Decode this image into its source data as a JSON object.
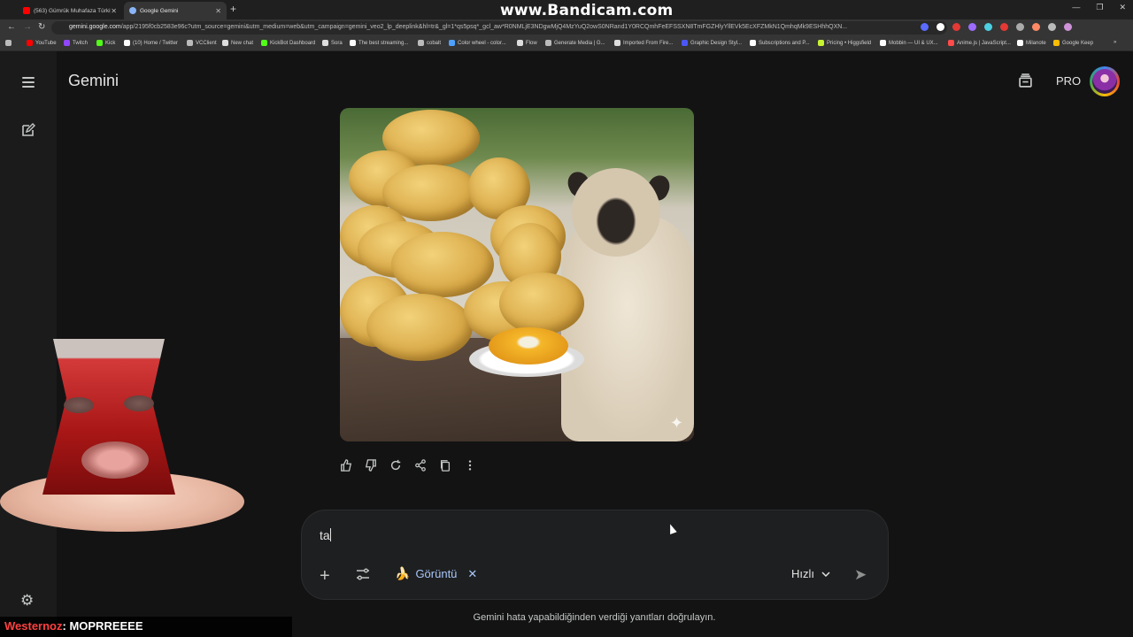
{
  "browser": {
    "tabs": [
      {
        "label": "(563) Gümrük Muhafaza Türkiye",
        "favicon_color": "#ff0000"
      },
      {
        "label": "Google Gemini",
        "favicon_color": "#8ab4f8"
      }
    ],
    "new_tab_icon": "plus-icon",
    "url_host": "gemini.google.com",
    "url_path": "/app/2195f0cb2583e96c?utm_source=gemini&utm_medium=web&utm_campaign=gemini_veo2_lp_deeplink&hl=tr&_gl=1*qs5psq*_gcl_aw*R0NMLjE3NDgwMjQ4MzYuQ2owS0NRand1Y0RCQmhFeEFSSXN8TmFGZHlyYllEVk5EcXFZMkN1QmhqMk9ESHhhQXN...",
    "bookmarks": [
      {
        "label": "YouTube",
        "color": "#ff0000"
      },
      {
        "label": "Twitch",
        "color": "#9146ff"
      },
      {
        "label": "Kick",
        "color": "#53fc18"
      },
      {
        "label": "(10) Home / Twitter",
        "color": "#ffffff"
      },
      {
        "label": "VCClient",
        "color": "#bbbbbb"
      },
      {
        "label": "New chat",
        "color": "#dddddd"
      },
      {
        "label": "KickBot Dashboard",
        "color": "#53fc18"
      },
      {
        "label": "Sora",
        "color": "#dddddd"
      },
      {
        "label": "The best streaming...",
        "color": "#ffffff"
      },
      {
        "label": "cobalt",
        "color": "#bbbbbb"
      },
      {
        "label": "Color wheel - color...",
        "color": "#4ea1ff"
      },
      {
        "label": "Flow",
        "color": "#dddddd"
      },
      {
        "label": "Generate Media | G...",
        "color": "#bbbbbb"
      },
      {
        "label": "Imported From Fire...",
        "color": "#dddddd"
      },
      {
        "label": "Graphic Design Styl...",
        "color": "#4b57f5"
      },
      {
        "label": "Subscriptions and P...",
        "color": "#ffffff"
      },
      {
        "label": "Pricing • Higgsfield",
        "color": "#c6f432"
      },
      {
        "label": "Mobbin — UI & UX...",
        "color": "#ffffff"
      },
      {
        "label": "Anime.js | JavaScript...",
        "color": "#ff4b4b"
      },
      {
        "label": "Milanote",
        "color": "#ffffff"
      },
      {
        "label": "Google Keep",
        "color": "#fbbc04"
      }
    ],
    "watermark": "www.Bandicam.com"
  },
  "app": {
    "name": "Gemini",
    "pro_label": "PRO",
    "menu_icon": "hamburger-menu-icon",
    "new_chat_icon": "edit-icon",
    "settings_icon": "gear-icon",
    "history_icon": "archive-icon"
  },
  "response": {
    "image_alt": "generated-image-pug-with-mangoes",
    "actions": [
      "thumbs-up-icon",
      "thumbs-down-icon",
      "redo-icon",
      "share-icon",
      "copy-icon",
      "more-vert-icon"
    ]
  },
  "composer": {
    "text": "ta",
    "chip_label": "Görüntü",
    "chip_icon": "banana-icon",
    "mode_label": "Hızlı",
    "send_icon": "send-icon"
  },
  "disclaimer": "Gemini hata yapabildiğinden verdiği yanıtları doğrulayın.",
  "stream_overlay": {
    "chat_user": "Westernoz",
    "chat_message": ": MOPRREEEE"
  },
  "colors": {
    "background": "#131314",
    "sidebar": "#1b1b1c",
    "accent": "#a8c7fa"
  }
}
